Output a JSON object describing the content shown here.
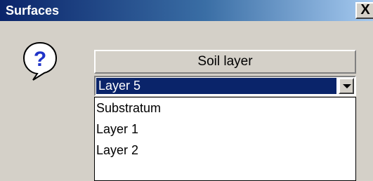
{
  "window": {
    "title": "Surfaces",
    "close_label": "X"
  },
  "icons": {
    "question": "question-mark-balloon-icon",
    "dropdown_arrow": "chevron-down-icon"
  },
  "group": {
    "header": "Soil layer"
  },
  "dropdown": {
    "selected": "Layer 5",
    "options": [
      "Substratum",
      "Layer 1",
      "Layer 2"
    ]
  },
  "colors": {
    "title_start": "#0a246a",
    "title_end": "#a6caf0",
    "selection": "#0a246a",
    "face": "#d4d0c8"
  }
}
